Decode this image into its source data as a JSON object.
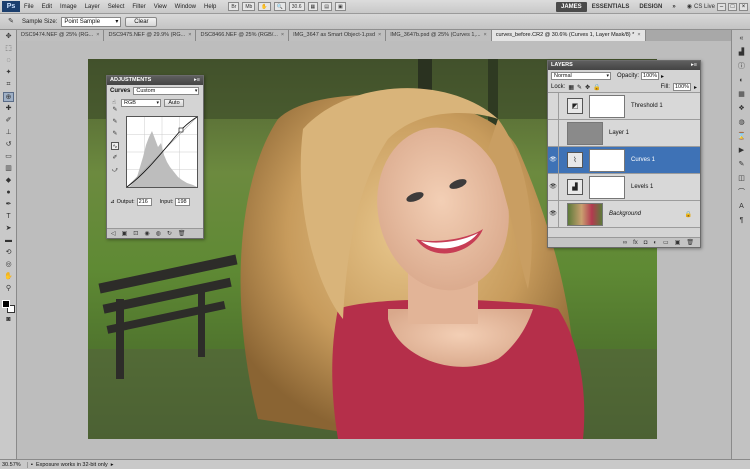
{
  "menubar": {
    "logo": "Ps",
    "items": [
      "File",
      "Edit",
      "Image",
      "Layer",
      "Select",
      "Filter",
      "View",
      "Window",
      "Help"
    ],
    "zoom": "30.6",
    "workspaces": [
      "JAMES",
      "ESSENTIALS",
      "DESIGN"
    ],
    "active_workspace": "JAMES",
    "cs_live": "CS Live"
  },
  "options": {
    "sample_label": "Sample Size:",
    "sample_value": "Point Sample",
    "clear_label": "Clear"
  },
  "tabs": [
    {
      "label": "DSC9474.NEF @ 25% (RG..."
    },
    {
      "label": "DSC9475.NEF @ 29.9% (RG..."
    },
    {
      "label": "DSC8466.NEF @ 25% (RGB/..."
    },
    {
      "label": "IMG_3647 as Smart Object-1.psd"
    },
    {
      "label": "IMG_3647b.psd @ 25% (Curves 1,..."
    },
    {
      "label": "curves_before.CR2 @ 30.6% (Curves 1, Layer Mask/8) *"
    }
  ],
  "active_tab": 5,
  "adjustments": {
    "title": "ADJUSTMENTS",
    "type_label": "Curves",
    "preset": "Custom",
    "channel": "RGB",
    "auto_label": "Auto",
    "output_label": "Output:",
    "output_value": "216",
    "input_label": "Input:",
    "input_value": "198"
  },
  "layers": {
    "title": "LAYERS",
    "blend_mode": "Normal",
    "opacity_label": "Opacity:",
    "opacity_value": "100%",
    "lock_label": "Lock:",
    "fill_label": "Fill:",
    "fill_value": "100%",
    "items": [
      {
        "name": "Threshold 1",
        "visible": false
      },
      {
        "name": "Layer 1",
        "visible": false
      },
      {
        "name": "Curves 1",
        "visible": true,
        "active": true
      },
      {
        "name": "Levels 1",
        "visible": true
      },
      {
        "name": "Background",
        "visible": true
      }
    ]
  },
  "status": {
    "zoom": "30.57%",
    "info": "Exposure works in 32-bit only"
  },
  "colors": {
    "accent": "#3e72b6",
    "panel_title": "#4c4c4c"
  }
}
